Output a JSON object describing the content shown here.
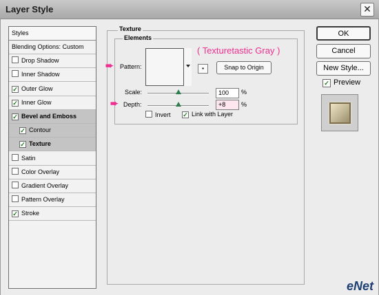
{
  "window": {
    "title": "Layer Style",
    "close_glyph": "✕"
  },
  "styles_panel": {
    "header": "Styles",
    "items": [
      {
        "label": "Blending Options: Custom",
        "checkbox": false,
        "checked": false,
        "selected": false,
        "indent": false,
        "bold": false
      },
      {
        "label": "Drop Shadow",
        "checkbox": true,
        "checked": false,
        "selected": false,
        "indent": false,
        "bold": false
      },
      {
        "label": "Inner Shadow",
        "checkbox": true,
        "checked": false,
        "selected": false,
        "indent": false,
        "bold": false
      },
      {
        "label": "Outer Glow",
        "checkbox": true,
        "checked": true,
        "selected": false,
        "indent": false,
        "bold": false
      },
      {
        "label": "Inner Glow",
        "checkbox": true,
        "checked": true,
        "selected": false,
        "indent": false,
        "bold": false
      },
      {
        "label": "Bevel and Emboss",
        "checkbox": true,
        "checked": true,
        "selected": true,
        "indent": false,
        "bold": true
      },
      {
        "label": "Contour",
        "checkbox": true,
        "checked": true,
        "selected": true,
        "indent": true,
        "bold": false
      },
      {
        "label": "Texture",
        "checkbox": true,
        "checked": true,
        "selected": true,
        "indent": true,
        "bold": true
      },
      {
        "label": "Satin",
        "checkbox": true,
        "checked": false,
        "selected": false,
        "indent": false,
        "bold": false
      },
      {
        "label": "Color Overlay",
        "checkbox": true,
        "checked": false,
        "selected": false,
        "indent": false,
        "bold": false
      },
      {
        "label": "Gradient Overlay",
        "checkbox": true,
        "checked": false,
        "selected": false,
        "indent": false,
        "bold": false
      },
      {
        "label": "Pattern Overlay",
        "checkbox": true,
        "checked": false,
        "selected": false,
        "indent": false,
        "bold": false
      },
      {
        "label": "Stroke",
        "checkbox": true,
        "checked": true,
        "selected": false,
        "indent": false,
        "bold": false
      }
    ]
  },
  "texture": {
    "group_title": "Texture",
    "elements_title": "Elements",
    "pattern_label": "Pattern:",
    "snap_button": "Snap to Origin",
    "scale_label": "Scale:",
    "scale_value": "100",
    "scale_unit": "%",
    "scale_fraction": 0.5,
    "depth_label": "Depth:",
    "depth_value": "+8",
    "depth_unit": "%",
    "depth_fraction": 0.5,
    "invert_label": "Invert",
    "invert_checked": false,
    "link_label": "Link with Layer",
    "link_checked": true
  },
  "annotation": {
    "pattern_name": "( Texturetastic Gray )",
    "arrow_glyph": "➨"
  },
  "buttons": {
    "ok": "OK",
    "cancel": "Cancel",
    "new_style": "New Style...",
    "preview_label": "Preview",
    "preview_checked": true
  },
  "watermark": "eNet",
  "colors": {
    "annotation": "#ee2f8f",
    "check": "#1c7a1c"
  }
}
